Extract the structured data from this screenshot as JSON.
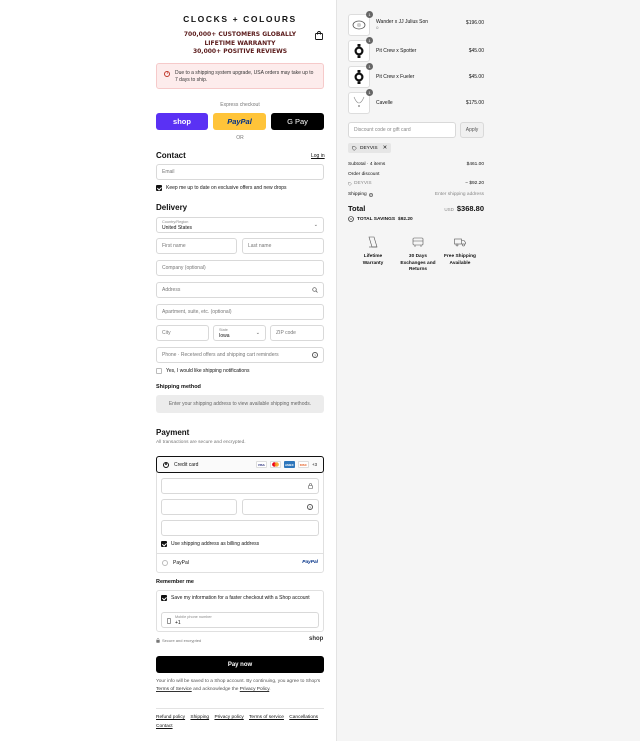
{
  "brand": {
    "name": "CLOCKS + COLOURS"
  },
  "promo": {
    "line1": "700,000+ Customers Globally",
    "line2": "Lifetime Warranty",
    "line3": "30,000+ Positive Reviews"
  },
  "notice": {
    "text": "Due to a shipping system upgrade, USA orders may take up to 7 days to ship."
  },
  "express": {
    "label": "Express checkout",
    "shop": "shop",
    "paypal": "PayPal",
    "gpay": "G Pay",
    "or": "OR"
  },
  "contact": {
    "title": "Contact",
    "login": "Log in",
    "email_placeholder": "Email",
    "newsletter": "Keep me up to date on exclusive offers and new drops"
  },
  "delivery": {
    "title": "Delivery",
    "country_label": "Country/Region",
    "country_value": "United States",
    "first_name": "First name",
    "last_name": "Last name",
    "company": "Company (optional)",
    "address": "Address",
    "apartment": "Apartment, suite, etc. (optional)",
    "city": "City",
    "state_label": "State",
    "state_value": "Iowa",
    "zip": "ZIP code",
    "phone": "Phone · Received offers and shipping cart reminders",
    "ship_notify": "Yes, I would like shipping notifications"
  },
  "shipping_method": {
    "title": "Shipping method",
    "message": "Enter your shipping address to view available shipping methods."
  },
  "payment": {
    "title": "Payment",
    "subtitle": "All transactions are secure and encrypted.",
    "credit_card": "Credit card",
    "more_cards": "+3",
    "cards": [
      "VISA",
      "MC",
      "AMEX",
      "DISC"
    ],
    "billing_same": "Use shipping address as billing address",
    "paypal": "PayPal",
    "paypal_logo": "PayPal"
  },
  "remember": {
    "title": "Remember me",
    "save_info": "Save my information for a faster checkout with a Shop account",
    "mobile_label": "Mobile phone number",
    "mobile_prefix": "+1",
    "secure": "Secure and encrypted",
    "shop_logo": "shop"
  },
  "pay_now": "Pay now",
  "terms": {
    "pre": "Your info will be saved to a Shop account. By continuing, you agree to Shop's",
    "tos": "Terms of Service",
    "mid": "and acknowledge the",
    "privacy": "Privacy Policy",
    "end": "."
  },
  "footer_links": [
    "Refund policy",
    "Shipping",
    "Privacy policy",
    "Terms of service",
    "Cancellations",
    "Contact"
  ],
  "cart": {
    "items": [
      {
        "name": "Wander x JJ Julius Son",
        "sub": "o",
        "qty": "1",
        "price": "$196.00"
      },
      {
        "name": "Pit Crew x Spotter",
        "sub": "",
        "qty": "1",
        "price": "$45.00"
      },
      {
        "name": "Pit Crew x Fueler",
        "sub": "",
        "qty": "1",
        "price": "$45.00"
      },
      {
        "name": "Cavelle",
        "sub": "",
        "qty": "1",
        "price": "$175.00"
      }
    ],
    "discount_placeholder": "Discount code or gift card",
    "apply": "Apply",
    "code": "DEYVIS",
    "subtotal_label": "Subtotal · 4 items",
    "subtotal": "$461.00",
    "order_discount_label": "Order discount",
    "discount_code": "DEYVIS",
    "discount_value": "− $92.20",
    "shipping_label": "Shipping",
    "shipping_value": "Enter shipping address",
    "total_label": "Total",
    "currency": "USD",
    "total": "$368.80",
    "savings_label": "TOTAL SAVINGS",
    "savings": "$92.20"
  },
  "perks": [
    {
      "line1": "Lifetime",
      "line2": "Warranty",
      "line3": ""
    },
    {
      "line1": "30 Days",
      "line2": "Exchanges and",
      "line3": "Returns"
    },
    {
      "line1": "Free Shipping",
      "line2": "Available",
      "line3": ""
    }
  ],
  "colors": {
    "shop": "#5a31f4",
    "paypal": "#ffc439",
    "gpay": "#000000",
    "notice_bg": "#fdecec",
    "pay_now": "#000000"
  }
}
